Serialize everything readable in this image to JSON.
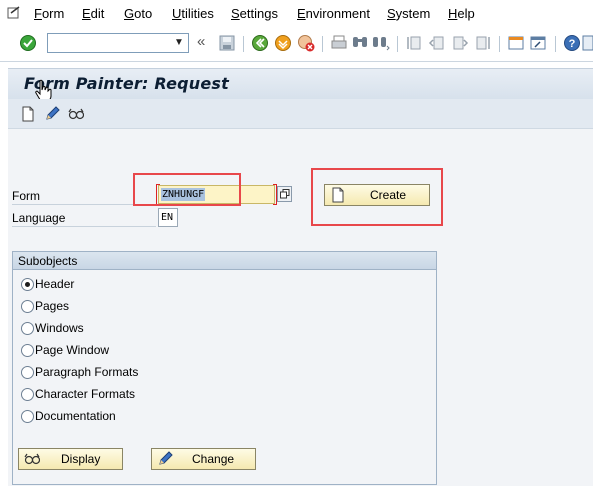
{
  "menu": {
    "items": [
      "Form",
      "Edit",
      "Goto",
      "Utilities",
      "Settings",
      "Environment",
      "System",
      "Help"
    ]
  },
  "toolbar": {
    "command_field_value": "",
    "icons": [
      "enter-icon",
      "save-icon",
      "back-icon",
      "exit-icon",
      "cancel-icon",
      "print-icon",
      "find-icon",
      "find-next-icon",
      "first-page-icon",
      "previous-page-icon",
      "next-page-icon",
      "last-page-icon",
      "create-session-icon",
      "shortcut-icon",
      "help-icon",
      "customize-layout-icon"
    ]
  },
  "title": "Form Painter: Request",
  "app_toolbar": {
    "icons": [
      "create-icon",
      "change-icon",
      "display-icon"
    ]
  },
  "fields": {
    "form_label": "Form",
    "form_value": "ZNHUNGF",
    "language_label": "Language",
    "language_value": "EN"
  },
  "buttons": {
    "create": "Create",
    "display": "Display",
    "change": "Change"
  },
  "subobjects": {
    "title": "Subobjects",
    "options": [
      {
        "label": "Header",
        "selected": true
      },
      {
        "label": "Pages",
        "selected": false
      },
      {
        "label": "Windows",
        "selected": false
      },
      {
        "label": "Page Window",
        "selected": false
      },
      {
        "label": "Paragraph Formats",
        "selected": false
      },
      {
        "label": "Character Formats",
        "selected": false
      },
      {
        "label": "Documentation",
        "selected": false
      }
    ]
  },
  "colors": {
    "highlight": "#e8474b",
    "input_bg": "#fdf4c7",
    "button_bg": "#f5e9b0"
  }
}
